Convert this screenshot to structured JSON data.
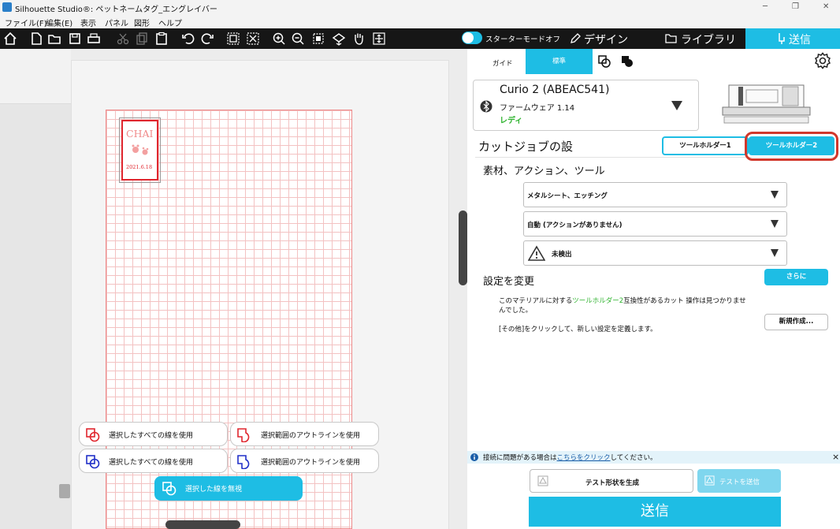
{
  "window": {
    "title": "Silhouette Studio®: ペットネームタグ_エングレイバー",
    "minimize": "─",
    "maximize": "❐",
    "close": "✕"
  },
  "menu": [
    "ファイル(F)",
    "編集(E)",
    "表示",
    "パネル",
    "図形",
    "ヘルプ"
  ],
  "top": {
    "starter_mode": "スターターモードオフ",
    "design_tab": "デザイン",
    "library_tab": "ライブラリ",
    "send_tab": "送信"
  },
  "canvas": {
    "tag": {
      "name": "CHAI",
      "date": "2021.6.18"
    },
    "buttons": {
      "use_all_red": "選択したすべての線を使用",
      "outline_red": "選択範囲のアウトラインを使用",
      "use_all_blue": "選択したすべての線を使用",
      "outline_blue": "選択範囲のアウトラインを使用",
      "ignore": "選択した線を無視"
    }
  },
  "panel": {
    "mode_guide": "ガイド",
    "mode_standard": "標準",
    "machine": {
      "name": "Curio 2 (ABEAC541)",
      "firmware": "ファームウェア 1.14",
      "status": "レディ"
    },
    "cut_job_title": "カットジョブの設",
    "tool_holder_1": "ツールホルダー1",
    "tool_holder_2": "ツールホルダー2",
    "section_title": "素材、アクション、ツール",
    "material": "メタルシート、エッチング",
    "action": "自動 (アクションがありません)",
    "tool": "未検出",
    "settings_title": "設定を変更",
    "more_button": "さらに",
    "message_pre": "このマテリアルに対する",
    "message_link": "ツールホルダー2",
    "message_post": "互換性があるカット 操作は見つかりませ",
    "message_line2": "んでした。",
    "other_hint": "[その他]をクリックして、新しい設定を定義します。",
    "new_button": "新規作成...",
    "info_pre": "接続に問題がある場合は",
    "info_link": "こちらをクリック",
    "info_post": "してください。",
    "info_close": "×",
    "test_generate": "テスト形状を生成",
    "test_send": "テストを送信",
    "send_button": "送信"
  },
  "colors": {
    "accent": "#1ebde4",
    "grid": "#f2a8a8",
    "tag_red": "#e0262e",
    "ready": "#2fb32f",
    "highlight": "#d2372b"
  }
}
